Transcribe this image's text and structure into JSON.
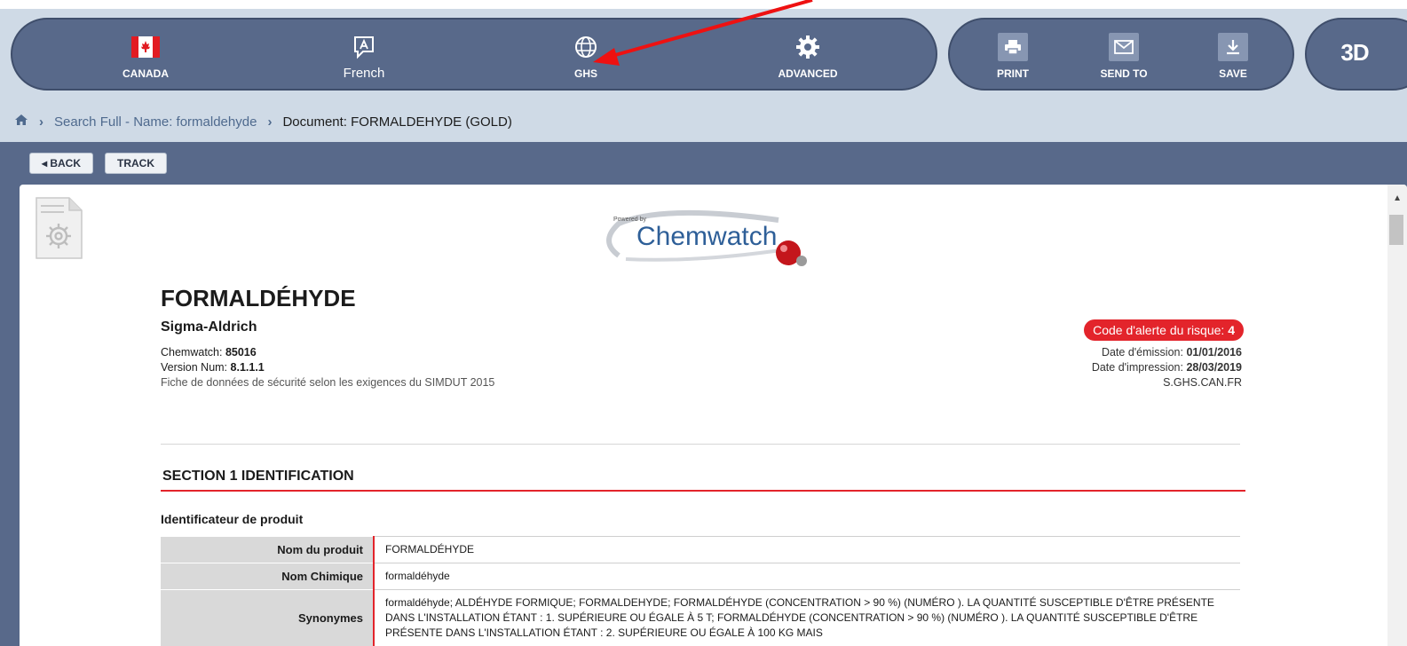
{
  "toolbar": {
    "items": [
      {
        "label": "CANADA",
        "icon": "canada-flag-icon"
      },
      {
        "label": "French",
        "icon": "language-icon"
      },
      {
        "label": "GHS",
        "icon": "globe-icon"
      },
      {
        "label": "ADVANCED",
        "icon": "gear-icon"
      }
    ],
    "actions": [
      {
        "label": "PRINT",
        "icon": "printer-icon"
      },
      {
        "label": "SEND TO",
        "icon": "envelope-icon"
      },
      {
        "label": "SAVE",
        "icon": "download-icon"
      }
    ],
    "threed_label": "3D"
  },
  "breadcrumb": {
    "home_icon": "home-icon",
    "items": [
      "Search Full - Name: formaldehyde",
      "Document: FORMALDEHYDE (GOLD)"
    ]
  },
  "nav": {
    "back_label": "◂ BACK",
    "track_label": "TRACK"
  },
  "document": {
    "logo_powered": "Powered by",
    "logo_name": "Chemwatch",
    "title": "FORMALDÉHYDE",
    "supplier": "Sigma-Aldrich",
    "chemwatch_label": "Chemwatch: ",
    "chemwatch_value": "85016",
    "version_label": "Version Num: ",
    "version_value": "8.1.1.1",
    "compliance": "Fiche de données de sécurité selon les exigences du SIMDUT 2015",
    "alert_label": "Code d'alerte du risque: ",
    "alert_value": "4",
    "issue_label": "Date d'émission: ",
    "issue_value": "01/01/2016",
    "print_label": "Date d'impression: ",
    "print_value": "28/03/2019",
    "doc_code": "S.GHS.CAN.FR",
    "section_title": "SECTION 1 IDENTIFICATION",
    "subheading": "Identificateur de produit",
    "rows": [
      {
        "label": "Nom du produit",
        "value": "FORMALDÉHYDE"
      },
      {
        "label": "Nom Chimique",
        "value": "formaldéhyde"
      },
      {
        "label": "Synonymes",
        "value": "formaldéhyde; ALDÉHYDE FORMIQUE; FORMALDEHYDE; FORMALDÉHYDE (CONCENTRATION > 90 %) (NUMÉRO ). LA QUANTITÉ SUSCEPTIBLE D'ÊTRE PRÉSENTE DANS L'INSTALLATION ÉTANT : 1. SUPÉRIEURE OU ÉGALE À 5 T; FORMALDÉHYDE (CONCENTRATION > 90 %) (NUMÉRO ). LA QUANTITÉ SUSCEPTIBLE D'ÊTRE PRÉSENTE DANS L'INSTALLATION ÉTANT : 2. SUPÉRIEURE OU ÉGALE À 100 KG MAIS"
      }
    ]
  },
  "colors": {
    "toolbar": "#58698a",
    "band": "#cfdae6",
    "accent_red": "#e3242b"
  }
}
